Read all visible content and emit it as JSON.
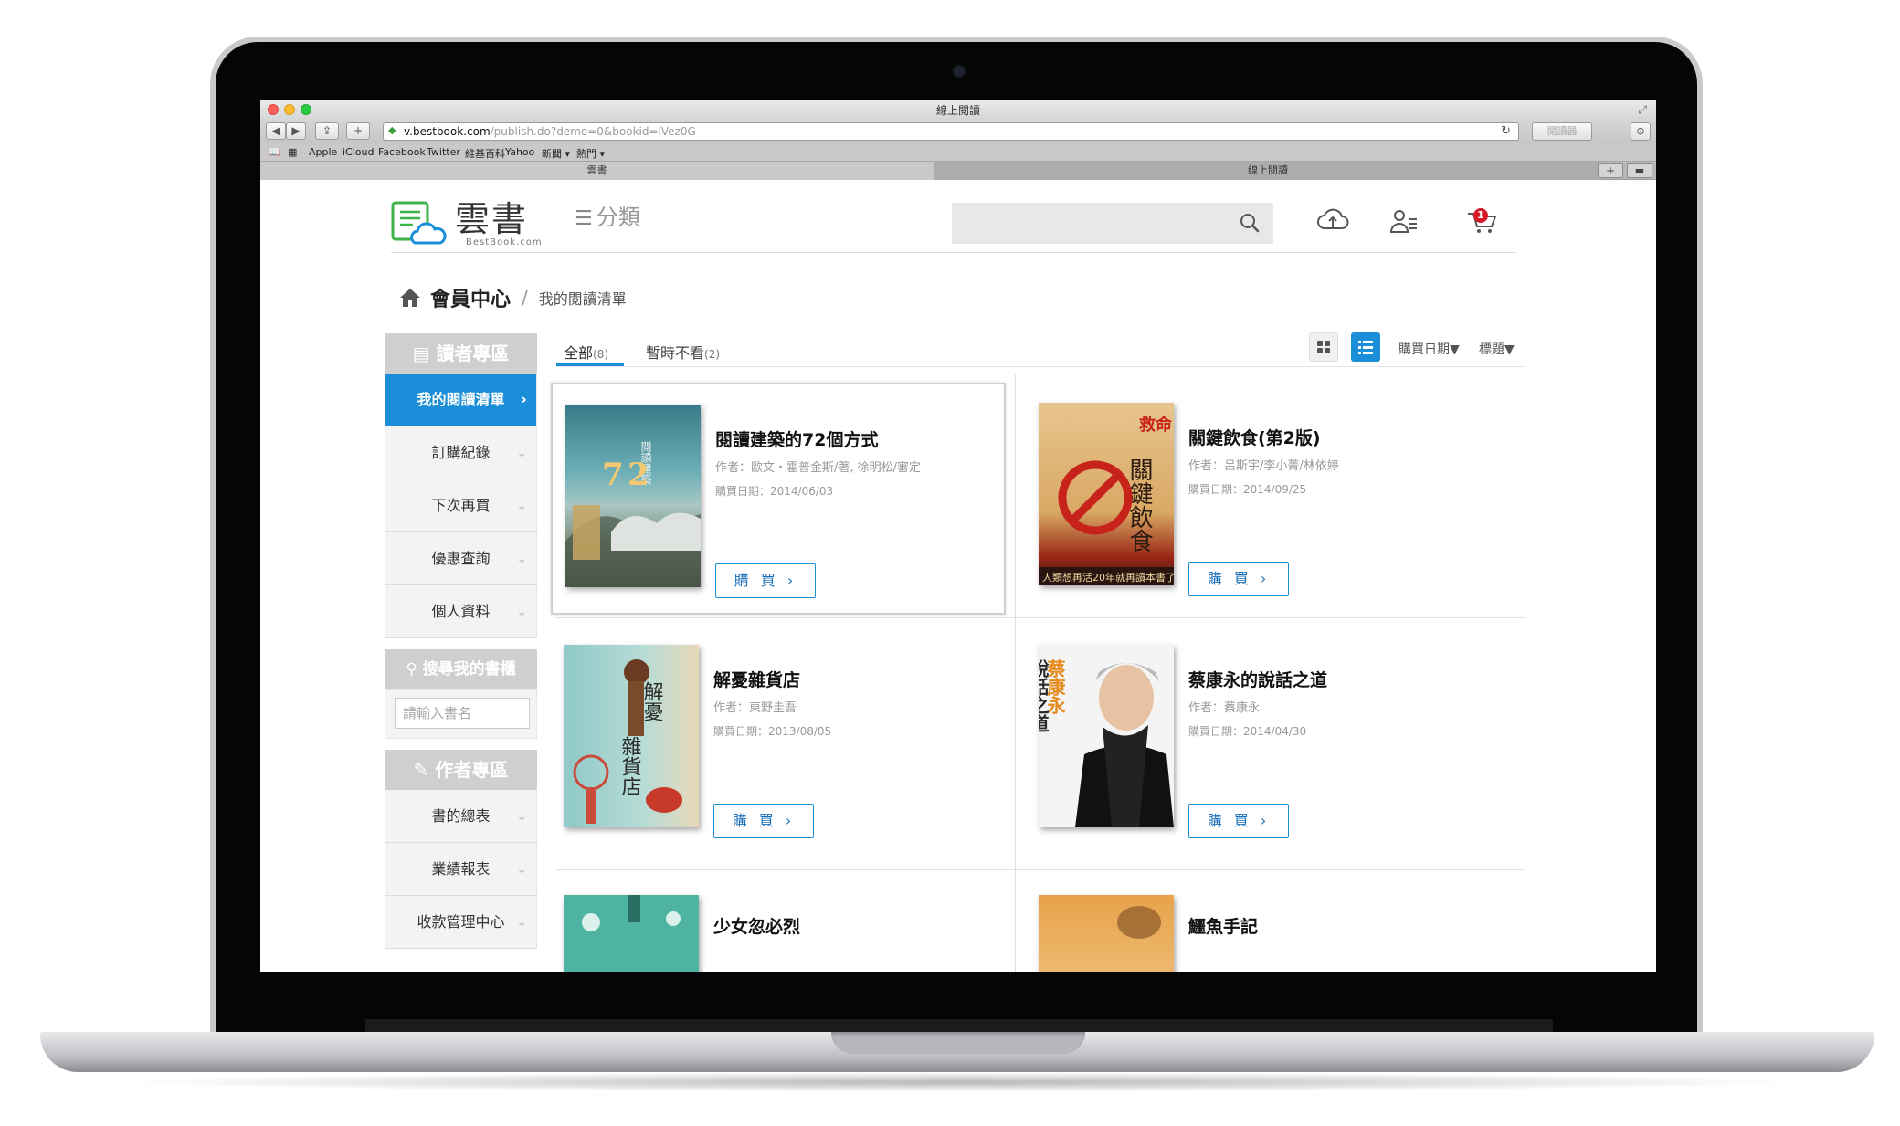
{
  "browser": {
    "window_title": "線上閱讀",
    "url_host": "v.bestbook.com",
    "url_path": "/publish.do?demo=0&bookid=lVez0G",
    "reader_label": "閱讀器",
    "bookmarks": [
      "Apple",
      "iCloud",
      "Facebook",
      "Twitter",
      "維基百科",
      "Yahoo",
      "新聞 ▾",
      "熱門 ▾"
    ],
    "tabs": [
      "雲書",
      "線上閱讀"
    ]
  },
  "header": {
    "logo_text": "雲書",
    "logo_sub": "BestBook.com",
    "category_label": "分類",
    "cart_count": "1"
  },
  "breadcrumb": {
    "main": "會員中心",
    "separator": "/",
    "current": "我的閱讀清單"
  },
  "sidebar": {
    "reader_section": "讀者專區",
    "reader_items": [
      {
        "label": "我的閱讀清單",
        "chevron": "›"
      },
      {
        "label": "訂購紀錄",
        "chevron": "⌄"
      },
      {
        "label": "下次再買",
        "chevron": "⌄"
      },
      {
        "label": "優惠查詢",
        "chevron": "⌄"
      },
      {
        "label": "個人資料",
        "chevron": "⌄"
      }
    ],
    "search_section": "搜尋我的書櫃",
    "search_placeholder": "請輸入書名",
    "author_section": "作者專區",
    "author_items": [
      {
        "label": "書的總表",
        "chevron": "⌄"
      },
      {
        "label": "業績報表",
        "chevron": "⌄"
      },
      {
        "label": "收款管理中心",
        "chevron": "⌄"
      }
    ]
  },
  "content": {
    "tab_all": "全部",
    "tab_all_count": "(8)",
    "tab_later": "暫時不看",
    "tab_later_count": "(2)",
    "sort_date": "購買日期▼",
    "sort_title": "標題▼",
    "buy_label": "購 買 ›",
    "books": [
      {
        "title": "閱讀建築的72個方式",
        "author": "作者：歐文・霍普金斯/著, 徐明松/審定",
        "date": "購買日期：2014/06/03"
      },
      {
        "title": "關鍵飲食(第2版)",
        "author": "作者：呂斯宇/李小菁/林依婷",
        "date": "購買日期：2014/09/25"
      },
      {
        "title": "解憂雜貨店",
        "author": "作者：東野圭吾",
        "date": "購買日期：2013/08/05"
      },
      {
        "title": "蔡康永的說話之道",
        "author": "作者：蔡康永",
        "date": "購買日期：2014/04/30"
      },
      {
        "title": "少女忽必烈",
        "author": "",
        "date": ""
      },
      {
        "title": "鱷魚手記",
        "author": "",
        "date": ""
      }
    ]
  },
  "colors": {
    "accent": "#1a8ed8",
    "cart_badge": "#d8192a",
    "sidebar_head": "#cfcfcf"
  }
}
